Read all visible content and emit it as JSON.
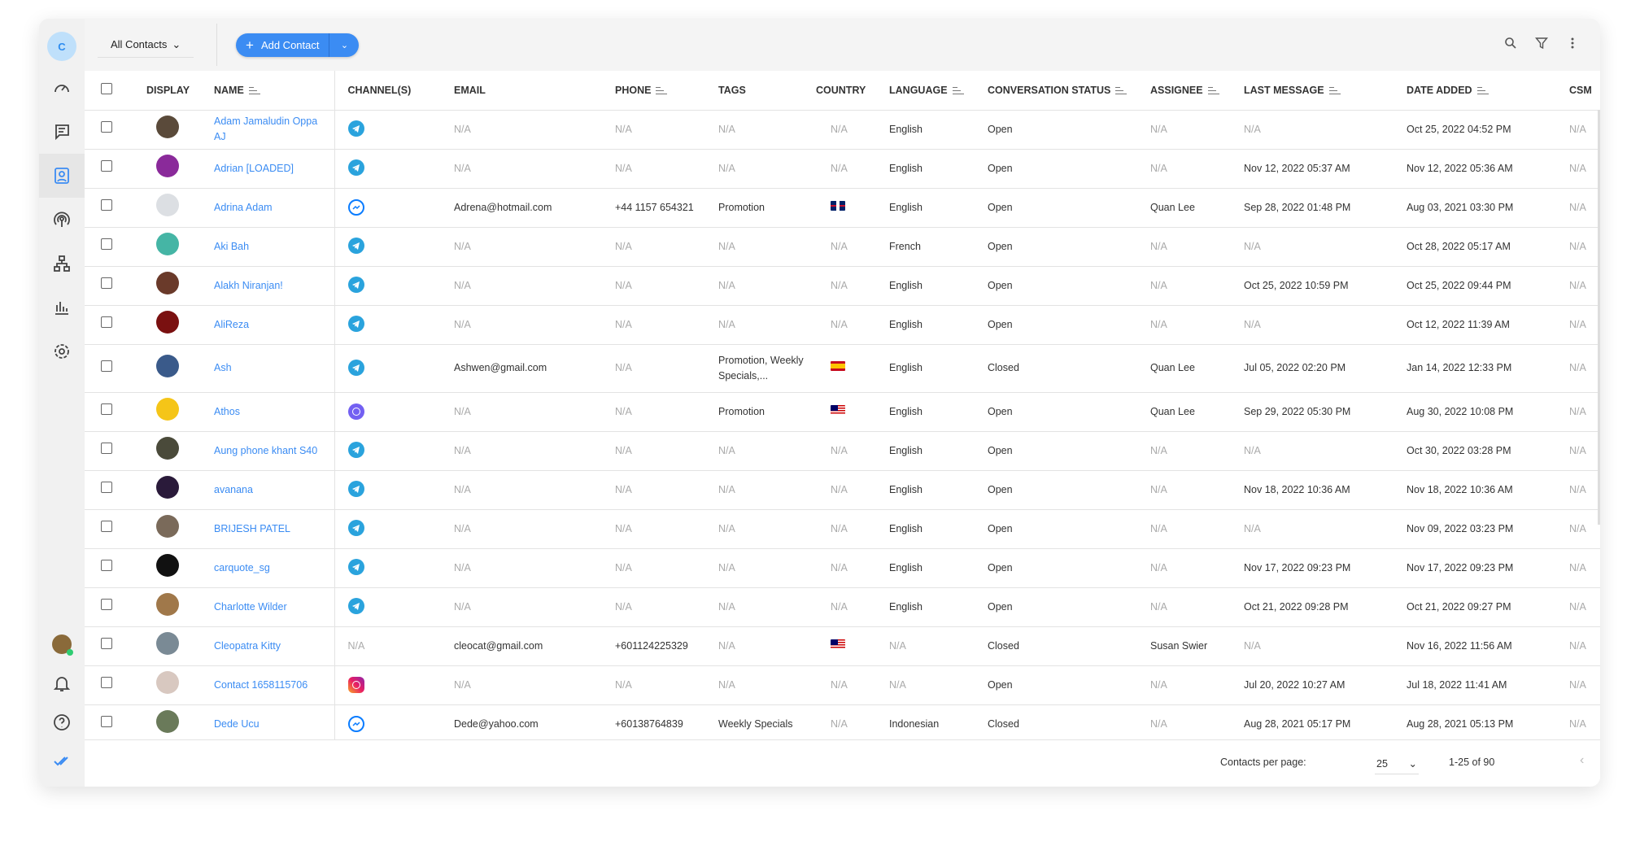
{
  "sidebar": {
    "user_initial": "C",
    "items": [
      "dashboard",
      "conversations",
      "contacts",
      "broadcast",
      "workflows",
      "reports",
      "settings"
    ],
    "bottom": [
      "profile",
      "notifications",
      "help",
      "logo"
    ]
  },
  "toolbar": {
    "view": "All Contacts",
    "add_label": "Add Contact"
  },
  "accent": "#3b8cf3",
  "columns": {
    "display": "DISPLAY",
    "name": "NAME",
    "channels": "CHANNEL(S)",
    "email": "EMAIL",
    "phone": "PHONE",
    "tags": "TAGS",
    "country": "COUNTRY",
    "language": "LANGUAGE",
    "status": "CONVERSATION STATUS",
    "assignee": "ASSIGNEE",
    "last_message": "LAST MESSAGE",
    "date_added": "DATE ADDED",
    "csm": "CSM"
  },
  "rows": [
    {
      "avatar": "#5a4a3a",
      "name": "Adam Jamaludin Oppa AJ",
      "channel": "telegram",
      "email": "N/A",
      "phone": "N/A",
      "tags": "N/A",
      "country": "N/A",
      "language": "English",
      "status": "Open",
      "assignee": "N/A",
      "last_message": "N/A",
      "date_added": "Oct 25, 2022 04:52 PM",
      "csm": "N/A"
    },
    {
      "avatar": "#8a2a9a",
      "name": "Adrian [LOADED]",
      "channel": "telegram",
      "email": "N/A",
      "phone": "N/A",
      "tags": "N/A",
      "country": "N/A",
      "language": "English",
      "status": "Open",
      "assignee": "N/A",
      "last_message": "Nov 12, 2022 05:37 AM",
      "date_added": "Nov 12, 2022 05:36 AM",
      "csm": "N/A"
    },
    {
      "avatar": "#dcdfe3",
      "name": "Adrina Adam",
      "channel": "messenger",
      "email": "Adrena@hotmail.com",
      "phone": "+44 1157 654321",
      "tags": "Promotion",
      "country": "uk",
      "language": "English",
      "status": "Open",
      "assignee": "Quan Lee",
      "last_message": "Sep 28, 2022 01:48 PM",
      "date_added": "Aug 03, 2021 03:30 PM",
      "csm": "N/A"
    },
    {
      "avatar": "#45b5a5",
      "name": "Aki Bah",
      "channel": "telegram",
      "email": "N/A",
      "phone": "N/A",
      "tags": "N/A",
      "country": "N/A",
      "language": "French",
      "status": "Open",
      "assignee": "N/A",
      "last_message": "N/A",
      "date_added": "Oct 28, 2022 05:17 AM",
      "csm": "N/A"
    },
    {
      "avatar": "#6a3a2a",
      "name": "Alakh Niranjan!",
      "channel": "telegram",
      "email": "N/A",
      "phone": "N/A",
      "tags": "N/A",
      "country": "N/A",
      "language": "English",
      "status": "Open",
      "assignee": "N/A",
      "last_message": "Oct 25, 2022 10:59 PM",
      "date_added": "Oct 25, 2022 09:44 PM",
      "csm": "N/A"
    },
    {
      "avatar": "#7a1010",
      "name": "AliReza",
      "channel": "telegram",
      "email": "N/A",
      "phone": "N/A",
      "tags": "N/A",
      "country": "N/A",
      "language": "English",
      "status": "Open",
      "assignee": "N/A",
      "last_message": "N/A",
      "date_added": "Oct 12, 2022 11:39 AM",
      "csm": "N/A"
    },
    {
      "avatar": "#3a5a8a",
      "name": "Ash",
      "channel": "telegram",
      "email": "Ashwen@gmail.com",
      "phone": "N/A",
      "tags": "Promotion, Weekly Specials,...",
      "country": "spain",
      "language": "English",
      "status": "Closed",
      "assignee": "Quan Lee",
      "last_message": "Jul 05, 2022 02:20 PM",
      "date_added": "Jan 14, 2022 12:33 PM",
      "csm": "N/A",
      "tall": true
    },
    {
      "avatar": "#f5c518",
      "name": "Athos",
      "channel": "viber",
      "email": "N/A",
      "phone": "N/A",
      "tags": "Promotion",
      "country": "malaysia",
      "language": "English",
      "status": "Open",
      "assignee": "Quan Lee",
      "last_message": "Sep 29, 2022 05:30 PM",
      "date_added": "Aug 30, 2022 10:08 PM",
      "csm": "N/A"
    },
    {
      "avatar": "#4a4a3a",
      "name": "Aung phone khant S40",
      "channel": "telegram",
      "email": "N/A",
      "phone": "N/A",
      "tags": "N/A",
      "country": "N/A",
      "language": "English",
      "status": "Open",
      "assignee": "N/A",
      "last_message": "N/A",
      "date_added": "Oct 30, 2022 03:28 PM",
      "csm": "N/A"
    },
    {
      "avatar": "#2a1a3a",
      "name": "avanana",
      "channel": "telegram",
      "email": "N/A",
      "phone": "N/A",
      "tags": "N/A",
      "country": "N/A",
      "language": "English",
      "status": "Open",
      "assignee": "N/A",
      "last_message": "Nov 18, 2022 10:36 AM",
      "date_added": "Nov 18, 2022 10:36 AM",
      "csm": "N/A"
    },
    {
      "avatar": "#7a6a5a",
      "name": "BRIJESH PATEL",
      "channel": "telegram",
      "email": "N/A",
      "phone": "N/A",
      "tags": "N/A",
      "country": "N/A",
      "language": "English",
      "status": "Open",
      "assignee": "N/A",
      "last_message": "N/A",
      "date_added": "Nov 09, 2022 03:23 PM",
      "csm": "N/A"
    },
    {
      "avatar": "#111111",
      "name": "carquote_sg",
      "channel": "telegram",
      "email": "N/A",
      "phone": "N/A",
      "tags": "N/A",
      "country": "N/A",
      "language": "English",
      "status": "Open",
      "assignee": "N/A",
      "last_message": "Nov 17, 2022 09:23 PM",
      "date_added": "Nov 17, 2022 09:23 PM",
      "csm": "N/A"
    },
    {
      "avatar": "#a0784a",
      "name": "Charlotte Wilder",
      "channel": "telegram",
      "email": "N/A",
      "phone": "N/A",
      "tags": "N/A",
      "country": "N/A",
      "language": "English",
      "status": "Open",
      "assignee": "N/A",
      "last_message": "Oct 21, 2022 09:28 PM",
      "date_added": "Oct 21, 2022 09:27 PM",
      "csm": "N/A"
    },
    {
      "avatar": "#7a8a95",
      "name": "Cleopatra Kitty",
      "channel": "none",
      "channel_text": "N/A",
      "email": "cleocat@gmail.com",
      "phone": "+601124225329",
      "tags": "N/A",
      "country": "malaysia",
      "language": "N/A",
      "status": "Closed",
      "assignee": "Susan Swier",
      "last_message": "N/A",
      "date_added": "Nov 16, 2022 11:56 AM",
      "csm": "N/A"
    },
    {
      "avatar": "#d8c8c0",
      "name": "Contact 1658115706",
      "channel": "instagram",
      "email": "N/A",
      "phone": "N/A",
      "tags": "N/A",
      "country": "N/A",
      "language": "N/A",
      "status": "Open",
      "assignee": "N/A",
      "last_message": "Jul 20, 2022 10:27 AM",
      "date_added": "Jul 18, 2022 11:41 AM",
      "csm": "N/A"
    },
    {
      "avatar": "#6a7a5a",
      "name": "Dede Ucu",
      "channel": "messenger",
      "email": "Dede@yahoo.com",
      "phone": "+60138764839",
      "tags": "Weekly Specials",
      "country": "N/A",
      "language": "Indonesian",
      "status": "Closed",
      "assignee": "N/A",
      "last_message": "Aug 28, 2021 05:17 PM",
      "date_added": "Aug 28, 2021 05:13 PM",
      "csm": "N/A"
    }
  ],
  "footer": {
    "per_page_label": "Contacts per page:",
    "per_page": "25",
    "range": "1-25 of 90"
  }
}
